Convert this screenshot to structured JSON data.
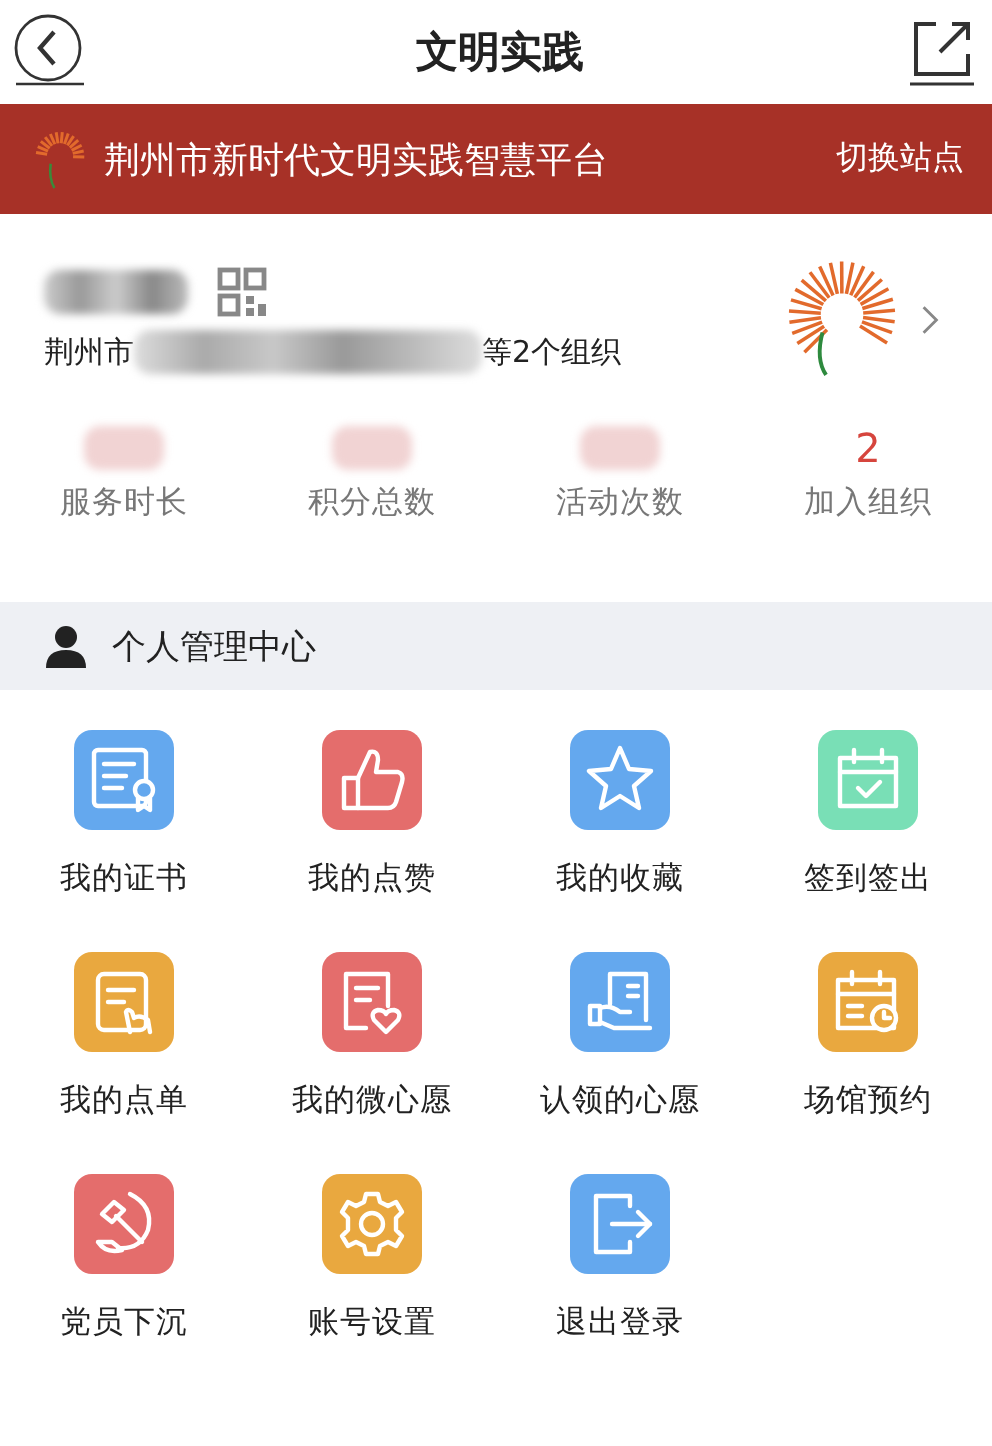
{
  "header": {
    "title": "文明实践"
  },
  "banner": {
    "title": "荆州市新时代文明实践智慧平台",
    "action": "切换站点"
  },
  "profile": {
    "org_prefix": "荆州市",
    "org_suffix": "等2个组织"
  },
  "stats": [
    {
      "label": "服务时长",
      "redacted": true
    },
    {
      "label": "积分总数",
      "redacted": true
    },
    {
      "label": "活动次数",
      "redacted": true
    },
    {
      "label": "加入组织",
      "redacted": false,
      "value": "2"
    }
  ],
  "section": {
    "title": "个人管理中心"
  },
  "tiles": [
    {
      "label": "我的证书",
      "kind": "certificate",
      "color": "#64a8ee"
    },
    {
      "label": "我的点赞",
      "kind": "thumb",
      "color": "#e46d6c"
    },
    {
      "label": "我的收藏",
      "kind": "star",
      "color": "#64a8ee"
    },
    {
      "label": "签到签出",
      "kind": "calendar-check",
      "color": "#79dfb6"
    },
    {
      "label": "我的点单",
      "kind": "order",
      "color": "#e9a83f"
    },
    {
      "label": "我的微心愿",
      "kind": "heart-doc",
      "color": "#e46d6c"
    },
    {
      "label": "认领的心愿",
      "kind": "hand-doc",
      "color": "#64a8ee"
    },
    {
      "label": "场馆预约",
      "kind": "calendar-clock",
      "color": "#e9a83f"
    },
    {
      "label": "党员下沉",
      "kind": "hammer-sickle",
      "color": "#e46d6c"
    },
    {
      "label": "账号设置",
      "kind": "gear",
      "color": "#e9a83f"
    },
    {
      "label": "退出登录",
      "kind": "logout",
      "color": "#64a8ee"
    }
  ]
}
